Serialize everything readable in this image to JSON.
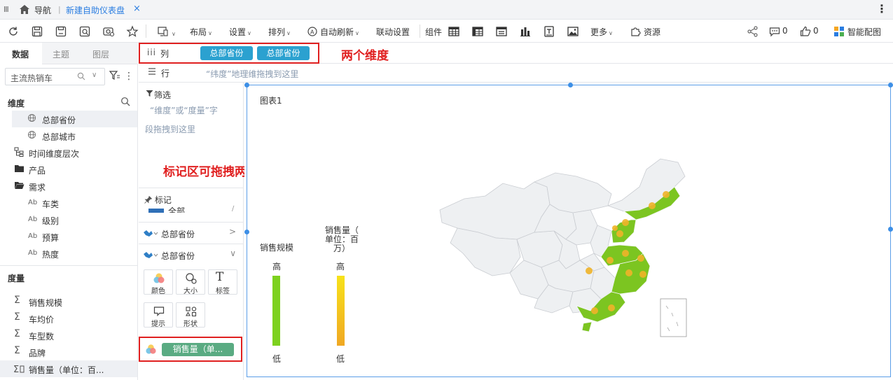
{
  "tabbar": {
    "nav_label": "导航",
    "separator": "|",
    "tab_label": "新建自助仪表盘",
    "close_glyph": "×"
  },
  "toolbar": {
    "layout_label": "布局",
    "settings_label": "设置",
    "arrange_label": "排列",
    "autorefresh_label": "自动刷新",
    "linkage_label": "联动设置",
    "components_label": "组件",
    "more_label": "更多",
    "resources_label": "资源",
    "comment_count": "0",
    "like_count": "0",
    "smart_chart_label": "智能配图"
  },
  "left_panel": {
    "tabs": [
      "数据",
      "主题",
      "图层"
    ],
    "dataset": "主流热销车",
    "dimensions_title": "维度",
    "dimensions": [
      {
        "label": "总部省份",
        "icon": "globe-icon"
      },
      {
        "label": "总部城市",
        "icon": "globe-icon"
      },
      {
        "label": "时间维度层次",
        "icon": "hierarchy-icon"
      },
      {
        "label": "产品",
        "icon": "folder-icon"
      },
      {
        "label": "需求",
        "icon": "folder-open-icon"
      },
      {
        "label": "车类",
        "icon": "text-field-icon"
      },
      {
        "label": "级别",
        "icon": "text-field-icon"
      },
      {
        "label": "预算",
        "icon": "text-field-icon"
      },
      {
        "label": "热度",
        "icon": "text-field-icon"
      }
    ],
    "measures_title": "度量",
    "measures": [
      {
        "label": "销售规模",
        "icon": "sigma-icon"
      },
      {
        "label": "车均价",
        "icon": "sigma-icon"
      },
      {
        "label": "车型数",
        "icon": "sigma-icon"
      },
      {
        "label": "品牌",
        "icon": "sigma-icon"
      },
      {
        "label": "销售量（单位：百...",
        "icon": "calc-measure-icon"
      }
    ]
  },
  "shelves": {
    "columns_label": "列",
    "column_pills": [
      "总部省份",
      "总部省份"
    ],
    "rows_label": "行",
    "rows_hint": "“纬度”地理维拖拽到这里",
    "filter_label": "筛选",
    "filter_hint_1": "“维度”或“度量”字",
    "filter_hint_2": "段拖拽到这里"
  },
  "marks": {
    "title": "标记",
    "cut_label": "全部",
    "layer_1": "总部省份",
    "layer_2": "总部省份",
    "buttons": [
      "颜色",
      "大小",
      "标签",
      "提示",
      "形状"
    ],
    "color_pill": "销售量（单..."
  },
  "annotations": {
    "columns_note": "两个维度",
    "marks_note": "标记区可拖拽两个度量并设置颜色"
  },
  "chart": {
    "title": "图表1",
    "legend_1": {
      "title": "销售规模",
      "high": "高",
      "low": "低",
      "color_top": "#7dd11e",
      "color_bottom": "#7dd11e"
    },
    "legend_2": {
      "title_l1": "销售量（",
      "title_l2": "单位：百",
      "title_l3": "万）",
      "high": "高",
      "low": "低",
      "color_top": "#f7e21a",
      "color_bottom": "#f0a823"
    }
  },
  "colors": {
    "accent": "#2a7de1",
    "pill_blue": "#2ba1d0",
    "pill_green": "#5aab82",
    "annotation_red": "#e02020",
    "map_base": "#eef0f2",
    "map_highlight": "#7cc521",
    "map_dot": "#f0b429"
  }
}
